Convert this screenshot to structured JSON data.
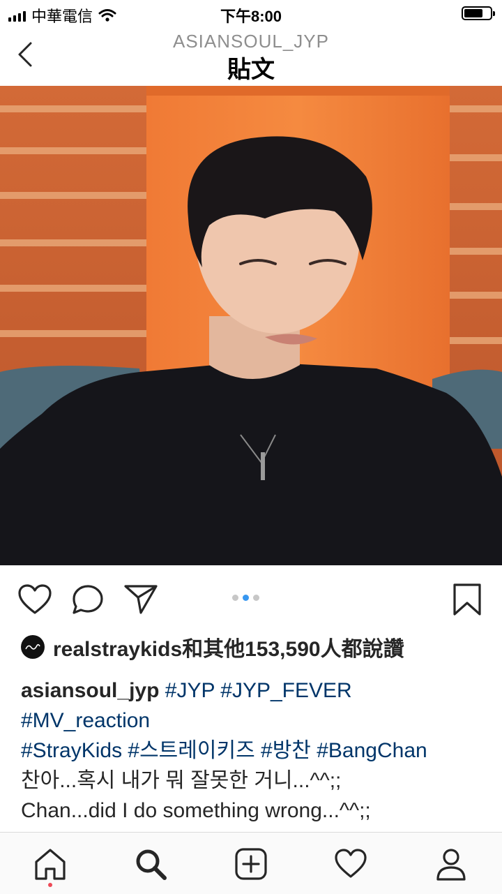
{
  "status_bar": {
    "carrier": "中華電信",
    "time": "下午8:00"
  },
  "nav": {
    "username": "ASIANSOUL_JYP",
    "title": "貼文"
  },
  "post": {
    "image_description": "Video still of a young man in a black shirt in front of an orange studio wall",
    "carousel": {
      "count": 3,
      "active_index": 1
    },
    "likes_text": "realstraykids和其他153,590人都說讚",
    "caption": {
      "username": "asiansoul_jyp",
      "hashtags_line1": "#JYP #JYP_FEVER",
      "hashtags_line2": "#MV_reaction",
      "hashtags_line3": "#StrayKids #스트레이키즈 #방찬 #BangChan",
      "text_korean": "찬아...혹시 내가 뭐 잘못한 거니...^^;;",
      "text_english": "Chan...did I do something wrong...^^;;"
    }
  },
  "icons": {
    "back": "chevron-left-icon",
    "like": "heart-icon",
    "comment": "comment-bubble-icon",
    "share": "paper-plane-icon",
    "save": "bookmark-icon",
    "tabs": [
      "home-icon",
      "search-icon",
      "add-post-icon",
      "activity-heart-icon",
      "profile-icon"
    ]
  },
  "colors": {
    "hashtag": "#003569",
    "carousel_active": "#3897f0",
    "notification_dot": "#ed4956"
  }
}
